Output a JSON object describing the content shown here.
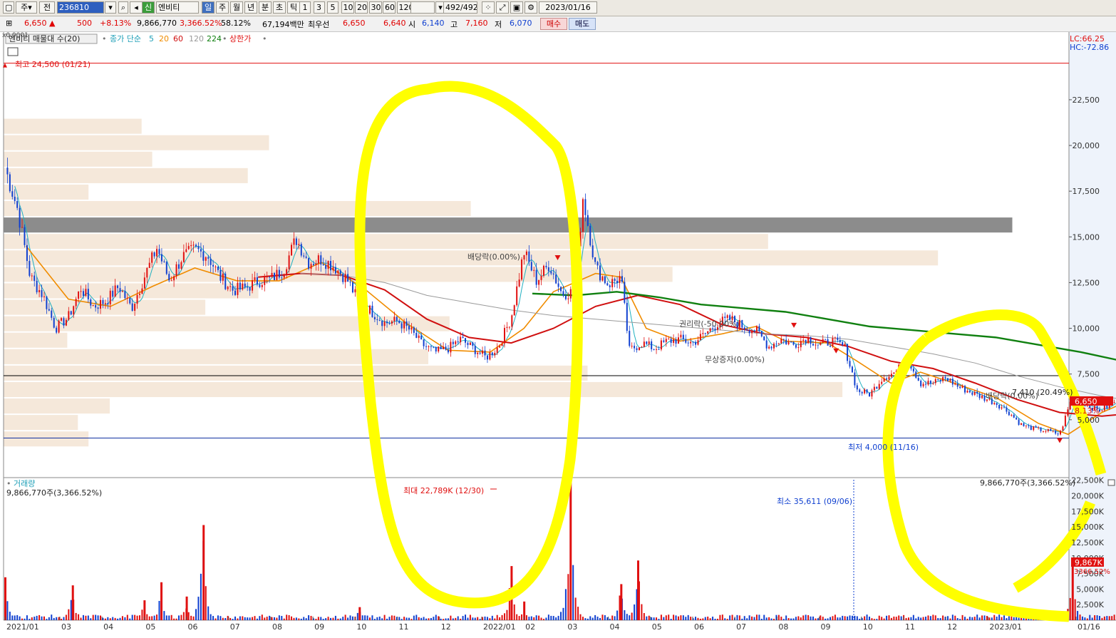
{
  "toolbar": {
    "mode_label": "주",
    "prev_label": "전",
    "code_value": "236810",
    "stock_flag": "신",
    "stock_name": "엔비티",
    "periods": [
      "일",
      "주",
      "월",
      "년",
      "분",
      "초",
      "틱"
    ],
    "selected_period": "일",
    "intervals": [
      "1",
      "3",
      "5",
      "10",
      "20",
      "30",
      "60",
      "120"
    ],
    "count": "492/492",
    "date": "2023/01/16"
  },
  "quote": {
    "price": "6,650",
    "arrow": "▲",
    "change": "500",
    "change_pct": "+8.13%",
    "volume": "9,866,770",
    "volume_pct": "3,366.52%",
    "turnover_pct": "58.12%",
    "amount": "67,194백만",
    "best_label": "최우선",
    "ask": "6,650",
    "bid": "6,640",
    "open_label": "시",
    "open": "6,140",
    "high_label": "고",
    "high": "7,160",
    "low_label": "저",
    "low": "6,070",
    "buy_label": "매수",
    "sell_label": "매도"
  },
  "legend": {
    "profile_label": "엔비티 매물대 수(20)",
    "ma_label": "종가 단순",
    "ma_periods": [
      "5",
      "20",
      "60",
      "120",
      "224"
    ],
    "limit_label": "상한가",
    "price_scale_label": "x0.0001"
  },
  "indicators": {
    "lc": "LC:66.25",
    "hc": "HC:-72.86"
  },
  "annotations": {
    "high_marker": "최고 24,500 (01/21)",
    "low_marker": "최저 4,000 (11/16)",
    "dividend_1": "배당락(0.00%)",
    "rights_1": "권리락(-50.00%)",
    "free_issue": "무상증자(0.00%)",
    "dividend_2": "배당락(0.00%)",
    "last_label": "7,410 (20.49%)",
    "price_tag": "6,650",
    "pct_tag": "8.13%",
    "volume_title": "거래량",
    "volume_info": "9,866,770주(3,366.52%)",
    "volume_info_right": "9,866,770주(3,366.52%)",
    "volume_max": "최대 22,789K (12/30)",
    "volume_min": "최소 35,611 (09/06)",
    "volume_tag": "9,867K",
    "volume_pct_tag": "3366.52%"
  },
  "colors": {
    "up": "#e01010",
    "down": "#1040d0",
    "ma5": "#20b0c0",
    "ma20": "#f08c00",
    "ma60": "#d01010",
    "ma120": "#9a9a9a",
    "ma224": "#108010",
    "profile": "#f5e8da",
    "profile_dark": "#8c8c8c",
    "highlight": "#ffff00"
  },
  "chart_data": {
    "type": "candlestick",
    "x_tick_labels": [
      "2021/01",
      "03",
      "04",
      "05",
      "06",
      "07",
      "08",
      "09",
      "10",
      "11",
      "12",
      "2022/01",
      "02",
      "03",
      "04",
      "05",
      "06",
      "07",
      "08",
      "09",
      "10",
      "11",
      "12",
      "2023/01",
      "01/16"
    ],
    "y_tick_labels": [
      "22,500",
      "20,000",
      "17,500",
      "15,000",
      "12,500",
      "10,000",
      "7,500",
      "5,000"
    ],
    "ylim": [
      3200,
      26200
    ],
    "volume_tick_labels": [
      "22,500K",
      "20,000K",
      "17,500K",
      "15,000K",
      "12,500K",
      "10,000K",
      "7,500K",
      "5,000K",
      "2,500K"
    ],
    "volume_ylim": [
      0,
      23500
    ],
    "close": [
      {
        "m": 0.0,
        "v": 18800
      },
      {
        "m": 0.3,
        "v": 16500
      },
      {
        "m": 0.6,
        "v": 12800
      },
      {
        "m": 0.9,
        "v": 11800
      },
      {
        "m": 1.2,
        "v": 10000
      },
      {
        "m": 1.5,
        "v": 10600
      },
      {
        "m": 1.8,
        "v": 12200
      },
      {
        "m": 2.1,
        "v": 11200
      },
      {
        "m": 2.4,
        "v": 11500
      },
      {
        "m": 2.7,
        "v": 12300
      },
      {
        "m": 3.0,
        "v": 11100
      },
      {
        "m": 3.3,
        "v": 12800
      },
      {
        "m": 3.6,
        "v": 14400
      },
      {
        "m": 3.9,
        "v": 12600
      },
      {
        "m": 4.2,
        "v": 13900
      },
      {
        "m": 4.5,
        "v": 14300
      },
      {
        "m": 4.8,
        "v": 14000
      },
      {
        "m": 5.1,
        "v": 12800
      },
      {
        "m": 5.4,
        "v": 12100
      },
      {
        "m": 5.7,
        "v": 12200
      },
      {
        "m": 6.0,
        "v": 12600
      },
      {
        "m": 6.3,
        "v": 12700
      },
      {
        "m": 6.6,
        "v": 13200
      },
      {
        "m": 6.9,
        "v": 14900
      },
      {
        "m": 7.2,
        "v": 13600
      },
      {
        "m": 7.5,
        "v": 13800
      },
      {
        "m": 7.8,
        "v": 13400
      },
      {
        "m": 8.1,
        "v": 12700
      },
      {
        "m": 8.4,
        "v": 11400
      },
      {
        "m": 8.7,
        "v": 10900
      },
      {
        "m": 9.0,
        "v": 10300
      },
      {
        "m": 9.3,
        "v": 10400
      },
      {
        "m": 9.6,
        "v": 9900
      },
      {
        "m": 9.9,
        "v": 9100
      },
      {
        "m": 10.2,
        "v": 8700
      },
      {
        "m": 10.5,
        "v": 8900
      },
      {
        "m": 10.8,
        "v": 9400
      },
      {
        "m": 11.1,
        "v": 8900
      },
      {
        "m": 11.4,
        "v": 8400
      },
      {
        "m": 11.7,
        "v": 9000
      },
      {
        "m": 12.0,
        "v": 10600
      },
      {
        "m": 12.3,
        "v": 14200
      },
      {
        "m": 12.6,
        "v": 12600
      },
      {
        "m": 12.9,
        "v": 13500
      },
      {
        "m": 13.2,
        "v": 11900
      },
      {
        "m": 13.5,
        "v": 12000
      },
      {
        "m": 13.7,
        "v": 17200
      },
      {
        "m": 14.0,
        "v": 13300
      },
      {
        "m": 14.3,
        "v": 12400
      },
      {
        "m": 14.6,
        "v": 12800
      },
      {
        "m": 14.8,
        "v": 8800
      },
      {
        "m": 15.1,
        "v": 9200
      },
      {
        "m": 15.4,
        "v": 8900
      },
      {
        "m": 15.7,
        "v": 9300
      },
      {
        "m": 16.0,
        "v": 9400
      },
      {
        "m": 16.3,
        "v": 9200
      },
      {
        "m": 16.6,
        "v": 9700
      },
      {
        "m": 16.9,
        "v": 10300
      },
      {
        "m": 17.2,
        "v": 10500
      },
      {
        "m": 17.5,
        "v": 10100
      },
      {
        "m": 17.8,
        "v": 9900
      },
      {
        "m": 18.1,
        "v": 9000
      },
      {
        "m": 18.4,
        "v": 9400
      },
      {
        "m": 18.7,
        "v": 9100
      },
      {
        "m": 19.0,
        "v": 9500
      },
      {
        "m": 19.3,
        "v": 9100
      },
      {
        "m": 19.6,
        "v": 9300
      },
      {
        "m": 19.9,
        "v": 9000
      },
      {
        "m": 20.2,
        "v": 6600
      },
      {
        "m": 20.5,
        "v": 6400
      },
      {
        "m": 20.8,
        "v": 7300
      },
      {
        "m": 21.1,
        "v": 7600
      },
      {
        "m": 21.4,
        "v": 8300
      },
      {
        "m": 21.7,
        "v": 7000
      },
      {
        "m": 22.0,
        "v": 7000
      },
      {
        "m": 22.3,
        "v": 7300
      },
      {
        "m": 22.6,
        "v": 6800
      },
      {
        "m": 22.9,
        "v": 6500
      },
      {
        "m": 23.2,
        "v": 6200
      },
      {
        "m": 23.5,
        "v": 5900
      },
      {
        "m": 23.8,
        "v": 5400
      },
      {
        "m": 24.1,
        "v": 4700
      },
      {
        "m": 24.4,
        "v": 4500
      },
      {
        "m": 24.7,
        "v": 4400
      },
      {
        "m": 25.0,
        "v": 4200
      },
      {
        "m": 25.3,
        "v": 6300
      },
      {
        "m": 25.6,
        "v": 5900
      },
      {
        "m": 25.9,
        "v": 5500
      },
      {
        "m": 26.2,
        "v": 5800
      },
      {
        "m": 26.5,
        "v": 6400
      },
      {
        "m": 26.8,
        "v": 7300
      },
      {
        "m": 27.1,
        "v": 6700
      },
      {
        "m": 27.4,
        "v": 6900
      },
      {
        "m": 27.7,
        "v": 6100
      },
      {
        "m": 28.0,
        "v": 5700
      },
      {
        "m": 28.3,
        "v": 6100
      },
      {
        "m": 28.5,
        "v": 6650
      }
    ],
    "series": [
      {
        "name": "5",
        "values": "moving average of close (5 days)"
      },
      {
        "name": "20",
        "values": [
          {
            "m": 0.5,
            "v": 14500
          },
          {
            "m": 1.5,
            "v": 11600
          },
          {
            "m": 2.5,
            "v": 11200
          },
          {
            "m": 3.5,
            "v": 12300
          },
          {
            "m": 4.5,
            "v": 13300
          },
          {
            "m": 5.5,
            "v": 12600
          },
          {
            "m": 6.5,
            "v": 12600
          },
          {
            "m": 7.5,
            "v": 13600
          },
          {
            "m": 8.5,
            "v": 12200
          },
          {
            "m": 9.5,
            "v": 10300
          },
          {
            "m": 10.5,
            "v": 8800
          },
          {
            "m": 11.5,
            "v": 8700
          },
          {
            "m": 12.3,
            "v": 10000
          },
          {
            "m": 13.0,
            "v": 12000
          },
          {
            "m": 14.0,
            "v": 13000
          },
          {
            "m": 14.6,
            "v": 12800
          },
          {
            "m": 15.2,
            "v": 10000
          },
          {
            "m": 16.0,
            "v": 9300
          },
          {
            "m": 17.0,
            "v": 9700
          },
          {
            "m": 17.8,
            "v": 10100
          },
          {
            "m": 18.5,
            "v": 9300
          },
          {
            "m": 19.5,
            "v": 9200
          },
          {
            "m": 20.2,
            "v": 8200
          },
          {
            "m": 21.0,
            "v": 7000
          },
          {
            "m": 21.7,
            "v": 7600
          },
          {
            "m": 22.5,
            "v": 7000
          },
          {
            "m": 23.5,
            "v": 6200
          },
          {
            "m": 24.5,
            "v": 4800
          },
          {
            "m": 25.2,
            "v": 4200
          },
          {
            "m": 26.0,
            "v": 5400
          },
          {
            "m": 27.0,
            "v": 6400
          },
          {
            "m": 28.0,
            "v": 6300
          },
          {
            "m": 28.5,
            "v": 6300
          }
        ]
      },
      {
        "name": "60",
        "values": [
          {
            "m": 6.0,
            "v": 12800
          },
          {
            "m": 7.0,
            "v": 13000
          },
          {
            "m": 8.0,
            "v": 12900
          },
          {
            "m": 9.0,
            "v": 12100
          },
          {
            "m": 10.0,
            "v": 10500
          },
          {
            "m": 11.0,
            "v": 9500
          },
          {
            "m": 12.0,
            "v": 9200
          },
          {
            "m": 13.0,
            "v": 10000
          },
          {
            "m": 14.0,
            "v": 11200
          },
          {
            "m": 15.0,
            "v": 11800
          },
          {
            "m": 16.0,
            "v": 11300
          },
          {
            "m": 17.0,
            "v": 10200
          },
          {
            "m": 18.0,
            "v": 9700
          },
          {
            "m": 19.0,
            "v": 9500
          },
          {
            "m": 20.0,
            "v": 9000
          },
          {
            "m": 21.0,
            "v": 8200
          },
          {
            "m": 22.0,
            "v": 7800
          },
          {
            "m": 23.0,
            "v": 7000
          },
          {
            "m": 24.0,
            "v": 6100
          },
          {
            "m": 25.0,
            "v": 5400
          },
          {
            "m": 26.0,
            "v": 5200
          },
          {
            "m": 27.0,
            "v": 5400
          },
          {
            "m": 28.0,
            "v": 5600
          },
          {
            "m": 28.5,
            "v": 5900
          }
        ]
      },
      {
        "name": "120",
        "values": [
          {
            "m": 7.0,
            "v": 13000
          },
          {
            "m": 8.0,
            "v": 12900
          },
          {
            "m": 9.0,
            "v": 12500
          },
          {
            "m": 10.0,
            "v": 11800
          },
          {
            "m": 11.0,
            "v": 11400
          },
          {
            "m": 12.0,
            "v": 11000
          },
          {
            "m": 13.0,
            "v": 10700
          },
          {
            "m": 14.0,
            "v": 10500
          },
          {
            "m": 15.0,
            "v": 10300
          },
          {
            "m": 16.0,
            "v": 10100
          },
          {
            "m": 17.0,
            "v": 9900
          },
          {
            "m": 18.0,
            "v": 9700
          },
          {
            "m": 19.0,
            "v": 9600
          },
          {
            "m": 20.0,
            "v": 9400
          },
          {
            "m": 21.0,
            "v": 9000
          },
          {
            "m": 22.0,
            "v": 8600
          },
          {
            "m": 23.0,
            "v": 8100
          },
          {
            "m": 24.0,
            "v": 7400
          },
          {
            "m": 25.0,
            "v": 6800
          },
          {
            "m": 26.0,
            "v": 6300
          },
          {
            "m": 27.0,
            "v": 5900
          },
          {
            "m": 28.0,
            "v": 5700
          },
          {
            "m": 28.5,
            "v": 5600
          }
        ]
      },
      {
        "name": "224",
        "values": [
          {
            "m": 12.5,
            "v": 11900
          },
          {
            "m": 13.5,
            "v": 11800
          },
          {
            "m": 14.5,
            "v": 12000
          },
          {
            "m": 15.5,
            "v": 11700
          },
          {
            "m": 16.5,
            "v": 11300
          },
          {
            "m": 17.5,
            "v": 11100
          },
          {
            "m": 18.5,
            "v": 10900
          },
          {
            "m": 19.5,
            "v": 10500
          },
          {
            "m": 20.5,
            "v": 10100
          },
          {
            "m": 21.5,
            "v": 9900
          },
          {
            "m": 22.5,
            "v": 9700
          },
          {
            "m": 23.5,
            "v": 9500
          },
          {
            "m": 24.5,
            "v": 9100
          },
          {
            "m": 25.5,
            "v": 8700
          },
          {
            "m": 26.5,
            "v": 8200
          },
          {
            "m": 27.5,
            "v": 7600
          },
          {
            "m": 28.5,
            "v": 7300
          }
        ]
      }
    ],
    "volume_spikes_k": [
      {
        "m": 0.0,
        "v": 6900
      },
      {
        "m": 1.6,
        "v": 5600
      },
      {
        "m": 3.3,
        "v": 3200
      },
      {
        "m": 3.7,
        "v": 6100
      },
      {
        "m": 4.3,
        "v": 3800
      },
      {
        "m": 4.7,
        "v": 15300
      },
      {
        "m": 8.4,
        "v": 2100
      },
      {
        "m": 12.0,
        "v": 8700
      },
      {
        "m": 12.3,
        "v": 3000
      },
      {
        "m": 13.4,
        "v": 22789
      },
      {
        "m": 14.6,
        "v": 5800
      },
      {
        "m": 15.0,
        "v": 9600
      },
      {
        "m": 25.3,
        "v": 9400
      },
      {
        "m": 26.5,
        "v": 19100
      },
      {
        "m": 27.3,
        "v": 11800
      },
      {
        "m": 27.9,
        "v": 8000
      },
      {
        "m": 28.5,
        "v": 9867
      }
    ],
    "volume_profile": {
      "price_lo": 3500,
      "price_hi": 21500,
      "buckets": 20,
      "relative_volume": [
        0.08,
        0.07,
        0.1,
        0.79,
        0.55,
        0.4,
        0.06,
        0.42,
        0.19,
        0.24,
        0.63,
        0.88,
        0.72,
        0.95,
        0.44,
        0.08,
        0.23,
        0.14,
        0.25,
        0.13
      ],
      "peak_bucket": 13
    },
    "limit_up_days": [
      "2021/01/21"
    ],
    "markers": [
      {
        "label": "최고 24,500 (01/21)",
        "m": 0.0,
        "price": 24500
      },
      {
        "label": "최저 4,000 (11/16)",
        "m": 25.0,
        "price": 4000
      },
      {
        "label": "배당락(0.00%)",
        "m": 13.1,
        "price": 14000
      },
      {
        "label": "권리락(-50.00%)",
        "m": 18.7,
        "price": 10300
      },
      {
        "label": "무상증자(0.00%)",
        "m": 19.7,
        "price": 8900
      },
      {
        "label": "배당락(0.00%)",
        "m": 27.8,
        "price": 7000
      }
    ],
    "reference_lines": [
      24500,
      7410,
      4000
    ]
  }
}
